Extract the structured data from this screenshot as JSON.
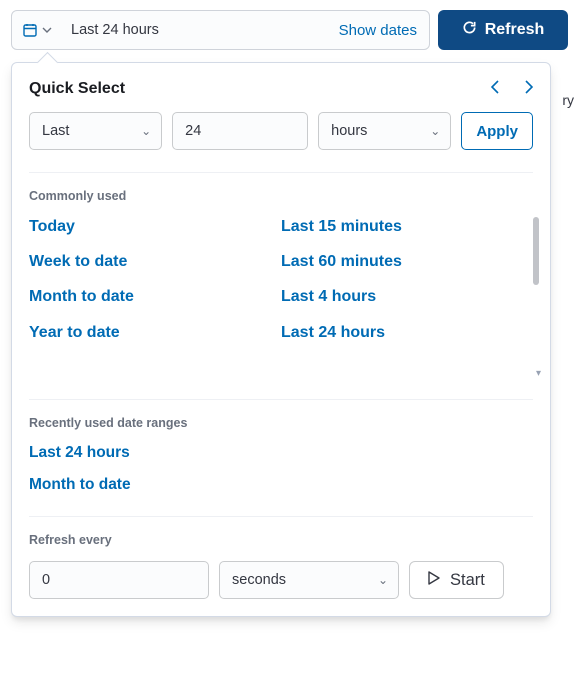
{
  "toolbar": {
    "date_text": "Last 24 hours",
    "show_dates": "Show dates",
    "refresh": "Refresh"
  },
  "bg_text": "ry",
  "quick_select": {
    "title": "Quick Select",
    "tense": "Last",
    "value": "24",
    "unit": "hours",
    "apply": "Apply"
  },
  "commonly_used": {
    "label": "Commonly used",
    "left": [
      "Today",
      "Week to date",
      "Month to date",
      "Year to date"
    ],
    "right": [
      "Last 15 minutes",
      "Last 60 minutes",
      "Last 4 hours",
      "Last 24 hours"
    ]
  },
  "recent": {
    "label": "Recently used date ranges",
    "items": [
      "Last 24 hours",
      "Month to date"
    ]
  },
  "refresh_section": {
    "label": "Refresh every",
    "value": "0",
    "unit": "seconds",
    "start": "Start"
  }
}
